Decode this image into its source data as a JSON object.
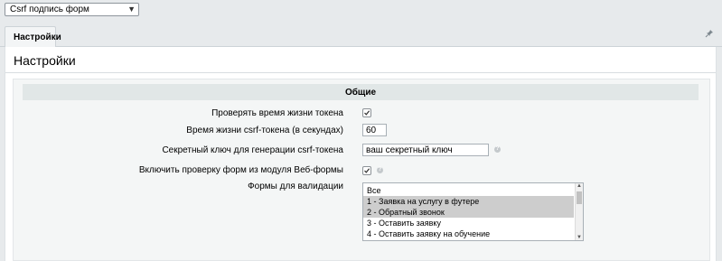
{
  "module_select": {
    "value": "Csrf подпись форм",
    "icon": "chevron-down-icon"
  },
  "tabs": [
    {
      "label": "Настройки"
    }
  ],
  "pin_icon": "pin-icon",
  "page_title": "Настройки",
  "section": {
    "title": "Общие",
    "fields": [
      {
        "label": "Проверять время жизни токена",
        "type": "checkbox",
        "checked": true
      },
      {
        "label": "Время жизни csrf-токена (в секундах)",
        "type": "input",
        "value": "60"
      },
      {
        "label": "Секретный ключ для генерации csrf-токена",
        "type": "input",
        "value": "ваш секретный ключ",
        "help_icon": "help-icon"
      },
      {
        "label": "Включить проверку форм из модуля Веб-формы",
        "type": "checkbox",
        "checked": true,
        "help_icon": "help-icon"
      },
      {
        "label": "Формы для валидации",
        "type": "multiselect",
        "options": [
          {
            "label": "Все",
            "selected": false
          },
          {
            "label": "1 - Заявка на услугу в футере",
            "selected": true
          },
          {
            "label": "2 - Обратный звонок",
            "selected": true
          },
          {
            "label": "3 - Оставить заявку",
            "selected": false
          },
          {
            "label": "4 - Оставить заявку на обучение",
            "selected": false
          }
        ]
      }
    ]
  },
  "colors": {
    "background": "#e7eaec",
    "section_header": "#e1e7e7",
    "selected_option": "#cdcdcd"
  }
}
